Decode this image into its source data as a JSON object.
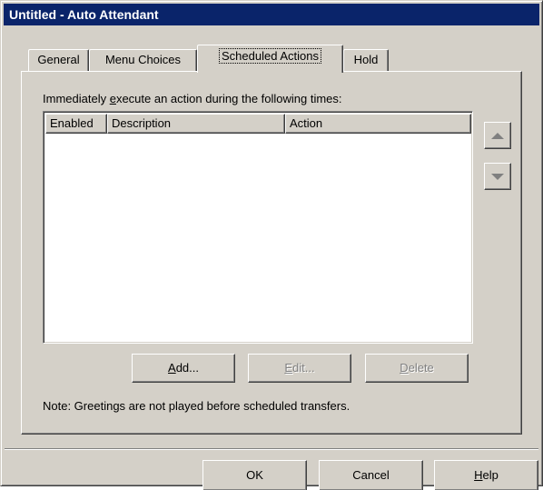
{
  "window": {
    "title": "Untitled - Auto Attendant"
  },
  "tabs": [
    {
      "label": "General"
    },
    {
      "label": "Menu Choices"
    },
    {
      "label": "Scheduled Actions",
      "active": true
    },
    {
      "label": "Hold"
    }
  ],
  "panel": {
    "intro_pre": "Immediately ",
    "intro_mn": "e",
    "intro_post": "xecute an action during the following times:",
    "columns": [
      "Enabled",
      "Description",
      "Action"
    ],
    "rows": [],
    "buttons": {
      "add_mn": "A",
      "add_rest": "dd...",
      "edit_mn": "E",
      "edit_rest": "dit...",
      "delete_mn": "D",
      "delete_rest": "elete"
    },
    "note": "Note:  Greetings are not played before scheduled transfers."
  },
  "footer": {
    "ok": "OK",
    "cancel": "Cancel",
    "help_mn": "H",
    "help_rest": "elp"
  },
  "icons": {
    "move_up": "triangle-up",
    "move_down": "triangle-down"
  }
}
